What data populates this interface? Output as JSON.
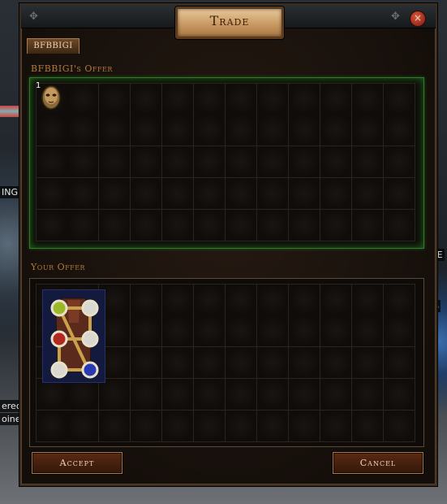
{
  "window": {
    "title": "Trade",
    "close_glyph": "×"
  },
  "tab": {
    "label": "BFBBIGI"
  },
  "their_offer": {
    "label": "BFBBIGI's Offer",
    "grid": {
      "columns": 12,
      "rows": 5
    },
    "items": [
      {
        "name": "mask-item-icon",
        "stack_count": "1"
      }
    ]
  },
  "your_offer": {
    "label": "Your Offer",
    "grid": {
      "columns": 12,
      "rows": 5
    },
    "items": [
      {
        "name": "body-armour-item-icon",
        "sockets": [
          "yellow-green",
          "white",
          "red",
          "white",
          "white",
          "blue"
        ]
      }
    ]
  },
  "buttons": {
    "accept": "Accept",
    "cancel": "Cancel"
  },
  "background_text": {
    "left_1": "ING",
    "left_2": "erec",
    "left_3": "oine",
    "right_1": "CE",
    "right_2": "S"
  },
  "colors": {
    "their_panel_glow": "#2f7a2c",
    "accent_gold": "#b07a3c",
    "button_bg": "#4a2210"
  }
}
